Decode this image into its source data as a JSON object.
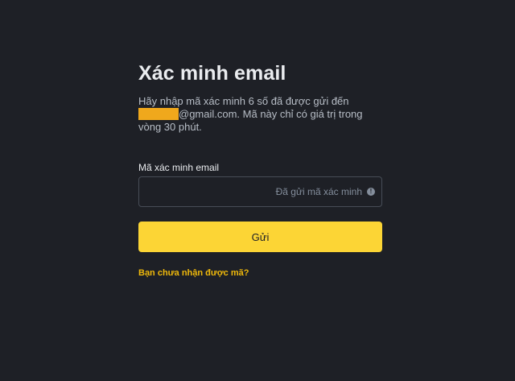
{
  "page": {
    "title": "Xác minh email",
    "description_line1": "Hãy nhập mã xác minh 6 số đã được gửi đến",
    "email_suffix": "@gmail.com. Mã này chỉ có giá trị trong vòng 30 phút."
  },
  "form": {
    "field_label": "Mã xác minh email",
    "input_value": "",
    "sent_status": "Đã gửi mã xác minh",
    "info_icon": "info-circle-icon",
    "submit_label": "Gửi",
    "resend_link": "Bạn chưa nhận được mã?"
  },
  "colors": {
    "background": "#1e2026",
    "accent": "#fcd535",
    "link": "#f0b90b",
    "redaction": "#f0a81c"
  }
}
